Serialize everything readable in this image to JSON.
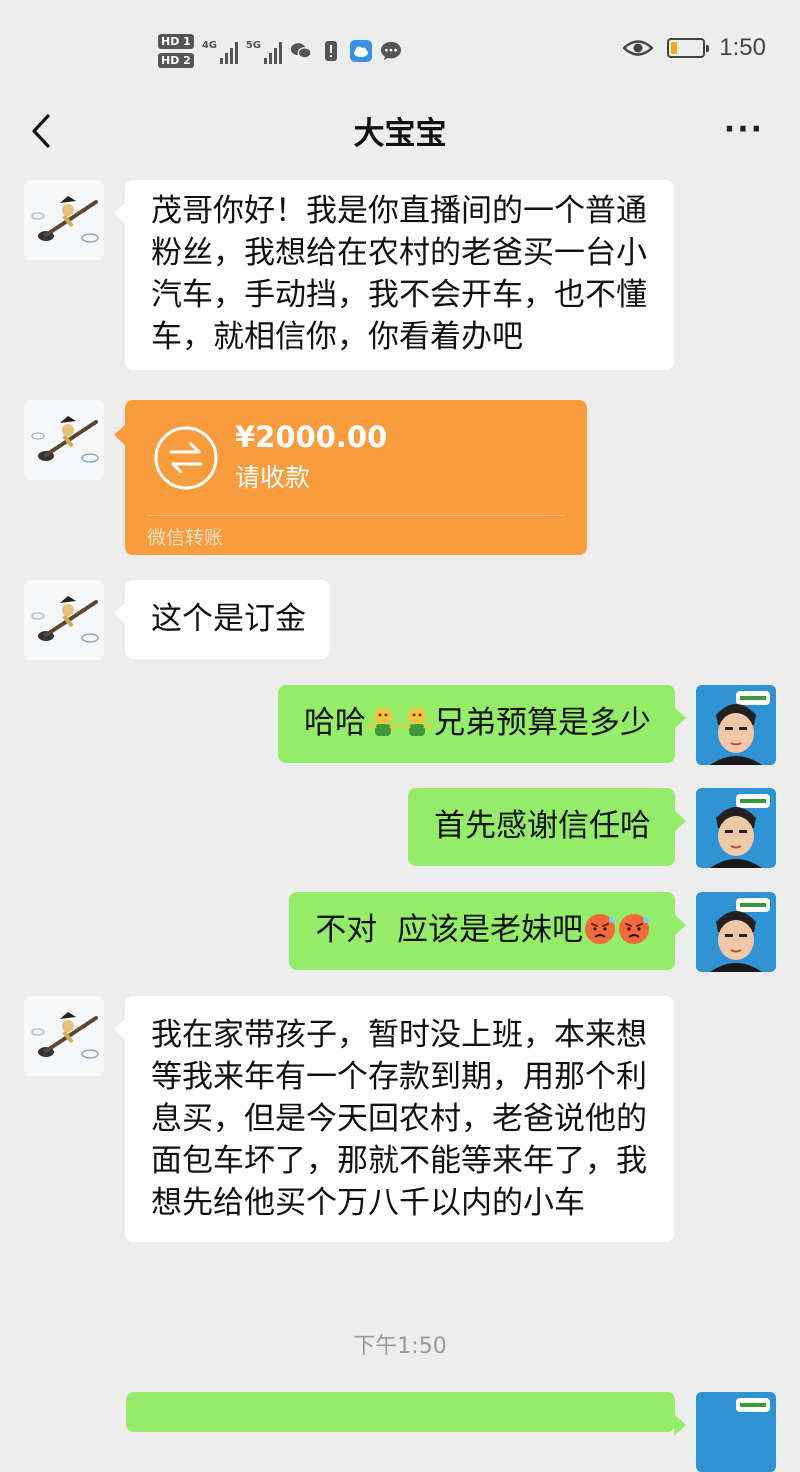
{
  "status_bar": {
    "hd1": "HD 1",
    "hd2": "HD 2",
    "signal1": "4G",
    "signal2": "5G",
    "time": "1:50",
    "battery_level": 0.2,
    "battery_color": "#f5a623"
  },
  "nav": {
    "back_icon": "chevron-left-icon",
    "title": "大宝宝",
    "more_icon": "more-dots-icon",
    "more": "···"
  },
  "messages": {
    "m1": "茂哥你好！我是你直播间的一个普通粉丝，我想给在农村的老爸买一台小汽车，手动挡，我不会开车，也不懂车，就相信你，你看着办吧",
    "transfer": {
      "amount": "¥2000.00",
      "status": "请收款",
      "footer": "微信转账",
      "color": "#f89c3e"
    },
    "m3": "这个是订金",
    "m4_prefix": "哈哈",
    "m4_suffix": "兄弟预算是多少",
    "m5": "首先感谢信任哈",
    "m6": "不对  应该是老妹吧",
    "m7": "我在家带孩子，暂时没上班，本来想等我来年有一个存款到期，用那个利息买，但是今天回农村，老爸说他的面包车坏了，那就不能等来年了，我想先给他买个万八千以内的小车"
  },
  "timestamp": "下午1:50",
  "colors": {
    "background": "#ededed",
    "bubble_self": "#95ec69",
    "bubble_other": "#ffffff"
  }
}
